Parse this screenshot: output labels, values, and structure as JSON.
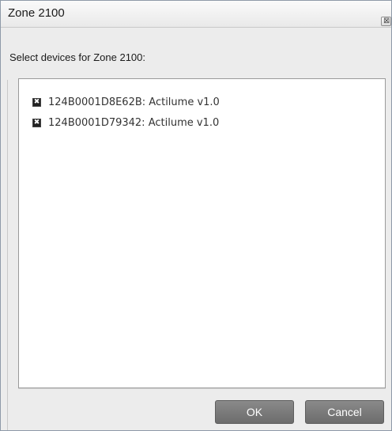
{
  "window": {
    "title": "Zone 2100",
    "close_icon": "close-icon"
  },
  "prompt": "Select devices for Zone 2100:",
  "devices": [
    {
      "label": "124B0001D8E62B: Actilume v1.0",
      "checked": true
    },
    {
      "label": "124B0001D79342: Actilume v1.0",
      "checked": true
    }
  ],
  "buttons": {
    "ok_label": "OK",
    "cancel_label": "Cancel"
  },
  "colors": {
    "button_bg": "#7a7a7a",
    "list_bg": "#ffffff",
    "dialog_bg": "#ececec"
  }
}
